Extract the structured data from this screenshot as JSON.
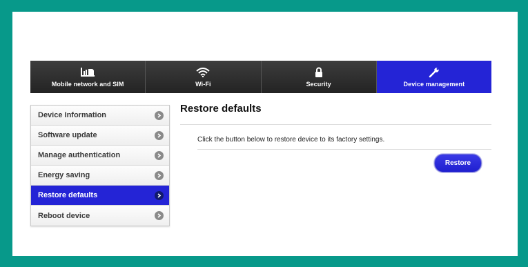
{
  "nav": {
    "tabs": [
      {
        "label": "Mobile network and SIM",
        "icon": "signal-sim-icon",
        "active": false
      },
      {
        "label": "Wi-Fi",
        "icon": "wifi-icon",
        "active": false
      },
      {
        "label": "Security",
        "icon": "lock-icon",
        "active": false
      },
      {
        "label": "Device management",
        "icon": "wrench-icon",
        "active": true
      }
    ]
  },
  "sidebar": {
    "items": [
      {
        "label": "Device Information",
        "active": false
      },
      {
        "label": "Software update",
        "active": false
      },
      {
        "label": "Manage authentication",
        "active": false
      },
      {
        "label": "Energy saving",
        "active": false
      },
      {
        "label": "Restore defaults",
        "active": true
      },
      {
        "label": "Reboot device",
        "active": false
      }
    ]
  },
  "main": {
    "title": "Restore defaults",
    "description": "Click the button below to restore device to its factory settings.",
    "restore_label": "Restore"
  },
  "colors": {
    "frame": "#07998a",
    "accent": "#2424d6",
    "nav_bg": "#2b2b2b"
  }
}
